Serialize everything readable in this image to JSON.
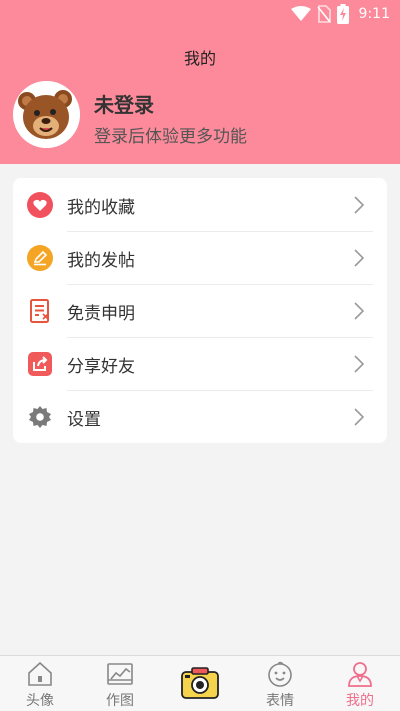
{
  "status_bar": {
    "time": "9:11",
    "icons": [
      "wifi-icon",
      "no-sim-icon",
      "battery-charging-icon"
    ]
  },
  "header": {
    "title": "我的",
    "avatar_icon": "bear-avatar-icon",
    "user_name": "未登录",
    "user_subtitle": "登录后体验更多功能",
    "background_color": "#fc8a9b"
  },
  "menu": {
    "items": [
      {
        "label": "我的收藏",
        "icon": "heart-icon",
        "color": "#f0515c"
      },
      {
        "label": "我的发帖",
        "icon": "edit-icon",
        "color": "#f5a524"
      },
      {
        "label": "免责申明",
        "icon": "document-icon",
        "color": "#e8553d"
      },
      {
        "label": "分享好友",
        "icon": "share-icon",
        "color": "#f05a5a"
      },
      {
        "label": "设置",
        "icon": "gear-icon",
        "color": "#7a7a7a"
      }
    ]
  },
  "tabbar": {
    "active_color": "#ef6f8c",
    "tabs": [
      {
        "label": "头像",
        "icon": "home-icon"
      },
      {
        "label": "作图",
        "icon": "image-chart-icon"
      },
      {
        "label": "",
        "icon": "camera-icon"
      },
      {
        "label": "表情",
        "icon": "baby-face-icon"
      },
      {
        "label": "我的",
        "icon": "person-icon",
        "active": true
      }
    ]
  }
}
